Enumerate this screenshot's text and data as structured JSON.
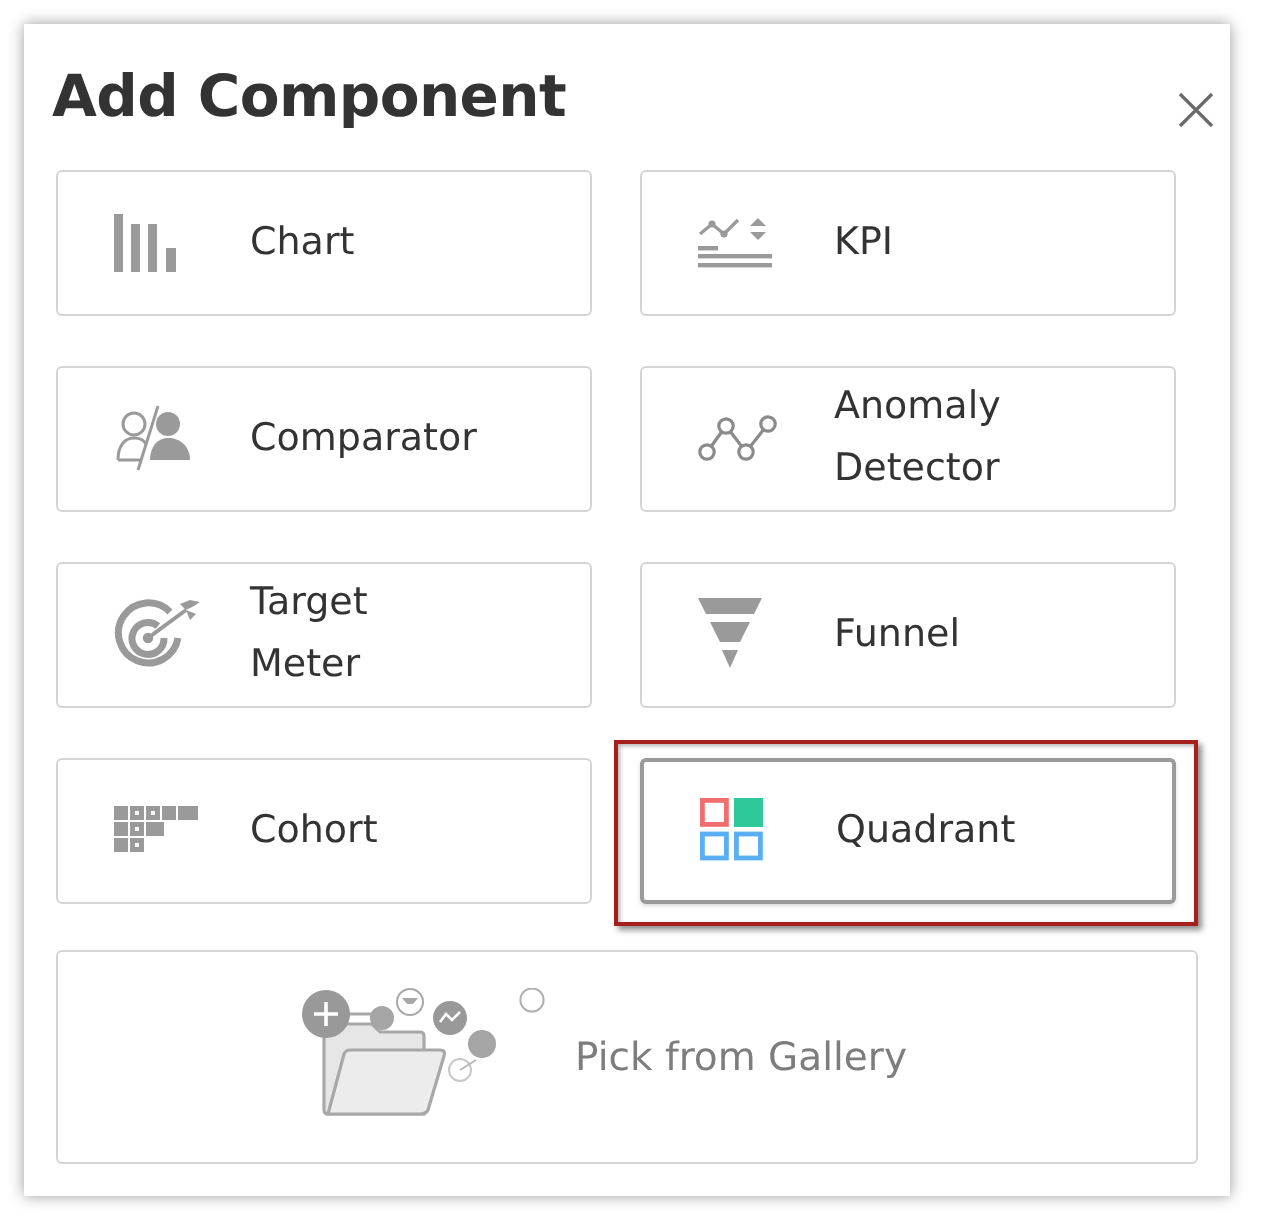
{
  "dialog": {
    "title": "Add Component"
  },
  "items": [
    {
      "kind": "chart",
      "label": "Chart",
      "highlighted": false
    },
    {
      "kind": "comparator",
      "label": "Comparator",
      "highlighted": false
    },
    {
      "kind": "target",
      "label": "Target\nMeter",
      "highlighted": false
    },
    {
      "kind": "cohort",
      "label": "Cohort",
      "highlighted": false
    },
    {
      "kind": "kpi",
      "label": "KPI",
      "highlighted": false
    },
    {
      "kind": "anomaly",
      "label": "Anomaly\nDetector",
      "highlighted": false
    },
    {
      "kind": "funnel",
      "label": "Funnel",
      "highlighted": false
    },
    {
      "kind": "quadrant",
      "label": "Quadrant",
      "highlighted": true
    }
  ],
  "gallery": {
    "label": "Pick from Gallery"
  }
}
